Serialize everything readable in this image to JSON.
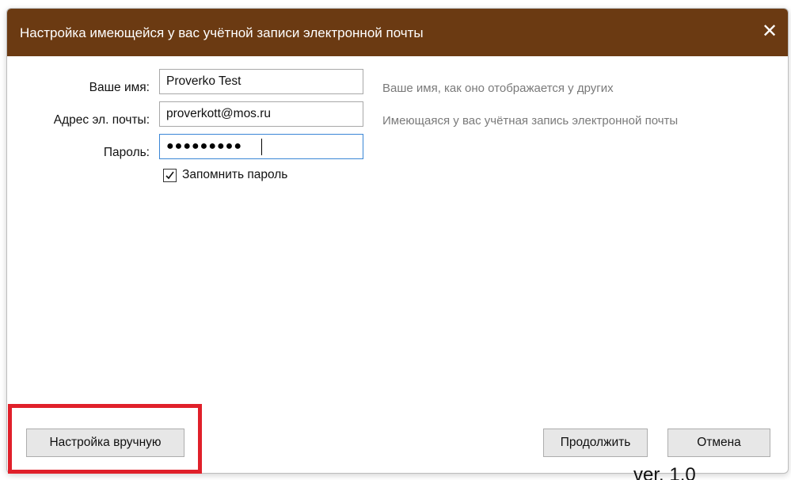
{
  "dialog": {
    "title": "Настройка имеющейся у вас учётной записи электронной почты",
    "close_glyph": "✕",
    "titlebar_color": "#6b3a12"
  },
  "form": {
    "name": {
      "label": "Ваше имя:",
      "value": "Proverko Test",
      "hint": "Ваше имя, как оно отображается у других"
    },
    "email": {
      "label": "Адрес эл. почты:",
      "value": "proverkott@mos.ru",
      "hint": "Имеющаяся у вас учётная запись электронной почты"
    },
    "password": {
      "label": "Пароль:",
      "masked_value": "●●●●●●●●●"
    },
    "remember": {
      "label": "Запомнить пароль",
      "checked": true
    }
  },
  "buttons": {
    "manual": "Настройка вручную",
    "continue": "Продолжить",
    "cancel": "Отмена"
  },
  "highlight_color": "#e0202a",
  "version": "ver. 1.0"
}
